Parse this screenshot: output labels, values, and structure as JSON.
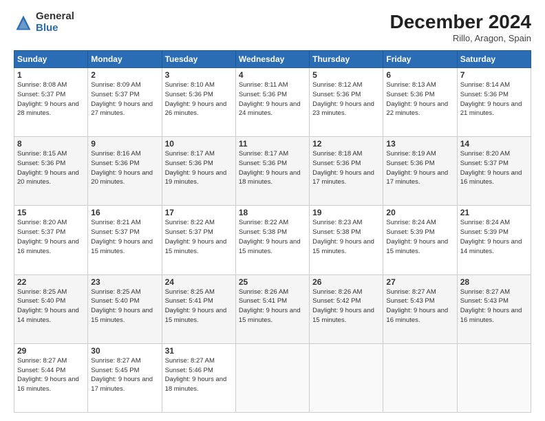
{
  "header": {
    "logo_general": "General",
    "logo_blue": "Blue",
    "month_title": "December 2024",
    "location": "Rillo, Aragon, Spain"
  },
  "days_of_week": [
    "Sunday",
    "Monday",
    "Tuesday",
    "Wednesday",
    "Thursday",
    "Friday",
    "Saturday"
  ],
  "weeks": [
    [
      {
        "day": 1,
        "sunrise": "8:08 AM",
        "sunset": "5:37 PM",
        "daylight": "9 hours and 28 minutes."
      },
      {
        "day": 2,
        "sunrise": "8:09 AM",
        "sunset": "5:37 PM",
        "daylight": "9 hours and 27 minutes."
      },
      {
        "day": 3,
        "sunrise": "8:10 AM",
        "sunset": "5:36 PM",
        "daylight": "9 hours and 26 minutes."
      },
      {
        "day": 4,
        "sunrise": "8:11 AM",
        "sunset": "5:36 PM",
        "daylight": "9 hours and 24 minutes."
      },
      {
        "day": 5,
        "sunrise": "8:12 AM",
        "sunset": "5:36 PM",
        "daylight": "9 hours and 23 minutes."
      },
      {
        "day": 6,
        "sunrise": "8:13 AM",
        "sunset": "5:36 PM",
        "daylight": "9 hours and 22 minutes."
      },
      {
        "day": 7,
        "sunrise": "8:14 AM",
        "sunset": "5:36 PM",
        "daylight": "9 hours and 21 minutes."
      }
    ],
    [
      {
        "day": 8,
        "sunrise": "8:15 AM",
        "sunset": "5:36 PM",
        "daylight": "9 hours and 20 minutes."
      },
      {
        "day": 9,
        "sunrise": "8:16 AM",
        "sunset": "5:36 PM",
        "daylight": "9 hours and 20 minutes."
      },
      {
        "day": 10,
        "sunrise": "8:17 AM",
        "sunset": "5:36 PM",
        "daylight": "9 hours and 19 minutes."
      },
      {
        "day": 11,
        "sunrise": "8:17 AM",
        "sunset": "5:36 PM",
        "daylight": "9 hours and 18 minutes."
      },
      {
        "day": 12,
        "sunrise": "8:18 AM",
        "sunset": "5:36 PM",
        "daylight": "9 hours and 17 minutes."
      },
      {
        "day": 13,
        "sunrise": "8:19 AM",
        "sunset": "5:36 PM",
        "daylight": "9 hours and 17 minutes."
      },
      {
        "day": 14,
        "sunrise": "8:20 AM",
        "sunset": "5:37 PM",
        "daylight": "9 hours and 16 minutes."
      }
    ],
    [
      {
        "day": 15,
        "sunrise": "8:20 AM",
        "sunset": "5:37 PM",
        "daylight": "9 hours and 16 minutes."
      },
      {
        "day": 16,
        "sunrise": "8:21 AM",
        "sunset": "5:37 PM",
        "daylight": "9 hours and 15 minutes."
      },
      {
        "day": 17,
        "sunrise": "8:22 AM",
        "sunset": "5:37 PM",
        "daylight": "9 hours and 15 minutes."
      },
      {
        "day": 18,
        "sunrise": "8:22 AM",
        "sunset": "5:38 PM",
        "daylight": "9 hours and 15 minutes."
      },
      {
        "day": 19,
        "sunrise": "8:23 AM",
        "sunset": "5:38 PM",
        "daylight": "9 hours and 15 minutes."
      },
      {
        "day": 20,
        "sunrise": "8:24 AM",
        "sunset": "5:39 PM",
        "daylight": "9 hours and 15 minutes."
      },
      {
        "day": 21,
        "sunrise": "8:24 AM",
        "sunset": "5:39 PM",
        "daylight": "9 hours and 14 minutes."
      }
    ],
    [
      {
        "day": 22,
        "sunrise": "8:25 AM",
        "sunset": "5:40 PM",
        "daylight": "9 hours and 14 minutes."
      },
      {
        "day": 23,
        "sunrise": "8:25 AM",
        "sunset": "5:40 PM",
        "daylight": "9 hours and 15 minutes."
      },
      {
        "day": 24,
        "sunrise": "8:25 AM",
        "sunset": "5:41 PM",
        "daylight": "9 hours and 15 minutes."
      },
      {
        "day": 25,
        "sunrise": "8:26 AM",
        "sunset": "5:41 PM",
        "daylight": "9 hours and 15 minutes."
      },
      {
        "day": 26,
        "sunrise": "8:26 AM",
        "sunset": "5:42 PM",
        "daylight": "9 hours and 15 minutes."
      },
      {
        "day": 27,
        "sunrise": "8:27 AM",
        "sunset": "5:43 PM",
        "daylight": "9 hours and 16 minutes."
      },
      {
        "day": 28,
        "sunrise": "8:27 AM",
        "sunset": "5:43 PM",
        "daylight": "9 hours and 16 minutes."
      }
    ],
    [
      {
        "day": 29,
        "sunrise": "8:27 AM",
        "sunset": "5:44 PM",
        "daylight": "9 hours and 16 minutes."
      },
      {
        "day": 30,
        "sunrise": "8:27 AM",
        "sunset": "5:45 PM",
        "daylight": "9 hours and 17 minutes."
      },
      {
        "day": 31,
        "sunrise": "8:27 AM",
        "sunset": "5:46 PM",
        "daylight": "9 hours and 18 minutes."
      },
      null,
      null,
      null,
      null
    ]
  ]
}
